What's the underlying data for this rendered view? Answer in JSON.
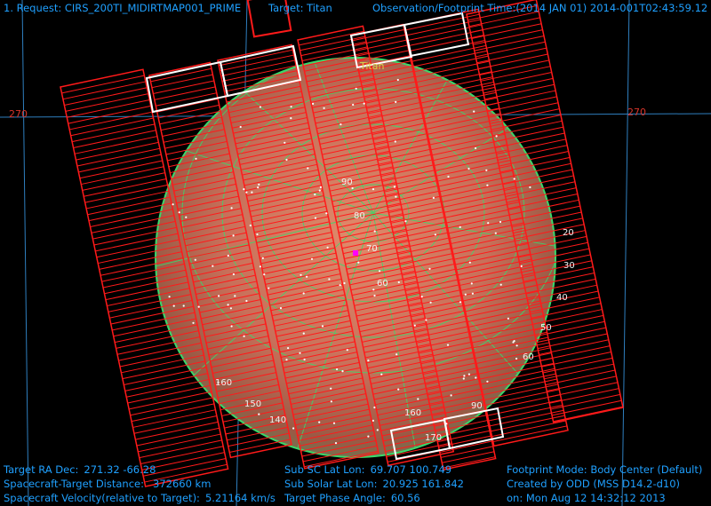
{
  "header": {
    "request": "1. Request: CIRS_200TI_MIDIRTMAP001_PRIME",
    "target": "Target: Titan",
    "obs_time": "Observation/Footprint Time:(2014 JAN 01) 2014-001T02:43:59.12"
  },
  "map": {
    "target_label": "Titan",
    "longitude_labels": [
      "270",
      "270"
    ],
    "grid_labels": [
      "90",
      "80",
      "70",
      "60",
      "20",
      "30",
      "40",
      "50",
      "60",
      "160",
      "150",
      "140",
      "160",
      "170",
      "90"
    ]
  },
  "footer": {
    "ra_dec_label": "Target RA Dec:",
    "ra_dec_value": "271.32   -66.28",
    "distance_label": "Spacecraft-Target Distance:",
    "distance_value": "372660 km",
    "velocity_label": "Spacecraft Velocity(relative to Target):",
    "velocity_value": "5.21164 km/s",
    "subsc_label": "Sub SC Lat Lon:",
    "subsc_value": "69.707   100.749",
    "subsolar_label": "Sub Solar Lat Lon:",
    "subsolar_value": "20.925   161.842",
    "phase_label": "Target Phase Angle:",
    "phase_value": "60.56",
    "footprint_mode": "Footprint Mode: Body Center (Default)",
    "created_by": "Created by ODD (MSS D14.2-d10)",
    "created_on": "on: Mon Aug 12 14:32:12 2013"
  },
  "colors": {
    "background": "#000000",
    "hud_text": "#1fa0ff",
    "footprint": "#ff1a1a",
    "grid": "#3cd86a",
    "highlight_footprint": "#ffffff",
    "sky_grid": "#2f7fbf",
    "marker": "#ff00ff"
  }
}
